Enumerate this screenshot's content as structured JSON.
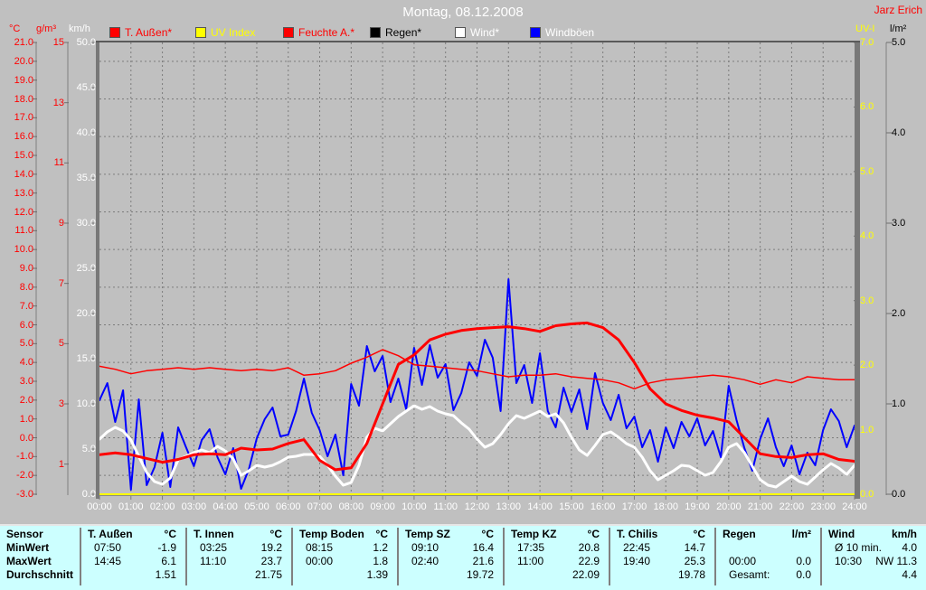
{
  "header": {
    "title": "Montag, 08.12.2008",
    "watermark": "Jarz Erich"
  },
  "legend": [
    {
      "label": "T. Außen*",
      "swatch": "#ff0000",
      "label_color": "#ff0000"
    },
    {
      "label": "UV Index",
      "swatch": "#ffff00",
      "label_color": "#ffff00"
    },
    {
      "label": "Feuchte A.*",
      "swatch": "#ff0000",
      "label_color": "#ff0000"
    },
    {
      "label": "Regen*",
      "swatch": "#000000",
      "label_color": "#000000"
    },
    {
      "label": "Wind*",
      "swatch": "#ffffff",
      "label_color": "#ffffff"
    },
    {
      "label": "Windböen",
      "swatch": "#0000ff",
      "label_color": "#ffffff"
    }
  ],
  "chart_data": {
    "type": "line",
    "title": "Montag, 08.12.2008",
    "x_axis": {
      "unit": "time",
      "range_hours": [
        0,
        24
      ],
      "tick_labels": [
        "00:00",
        "01:00",
        "02:00",
        "03:00",
        "04:00",
        "05:00",
        "06:00",
        "07:00",
        "08:00",
        "09:00",
        "10:00",
        "11:00",
        "12:00",
        "13:00",
        "14:00",
        "15:00",
        "16:00",
        "17:00",
        "18:00",
        "19:00",
        "20:00",
        "21:00",
        "22:00",
        "23:00",
        "24:00"
      ]
    },
    "grid": {
      "vertical": "every hour",
      "horizontal": "every 2 °C"
    },
    "legend_position": "top",
    "axes": [
      {
        "id": "temp_c",
        "label": "°C",
        "side": "left",
        "color": "#ff0000",
        "min": -3,
        "max": 21,
        "tick_step": 1,
        "decimals": 1
      },
      {
        "id": "humidity",
        "label": "g/m³",
        "side": "left",
        "color": "#ff0000",
        "min": 0,
        "max": 15,
        "tick_step": 2,
        "decimals": 0
      },
      {
        "id": "wind",
        "label": "km/h",
        "side": "left",
        "color": "#ffffff",
        "min": 0,
        "max": 50,
        "tick_step": 5,
        "decimals": 1
      },
      {
        "id": "uv",
        "label": "UV-I",
        "side": "right",
        "color": "#ffff00",
        "min": 0,
        "max": 7,
        "tick_step": 1,
        "decimals": 1
      },
      {
        "id": "rain",
        "label": "l/m²",
        "side": "right",
        "color": "#000000",
        "min": 0,
        "max": 5,
        "tick_step": 1,
        "decimals": 1
      }
    ],
    "series": [
      {
        "name": "T. Außen*",
        "axis": "temp_c",
        "color": "#ff0000",
        "width": 3,
        "step_h": 0.5,
        "values": [
          -0.9,
          -0.8,
          -0.9,
          -1.1,
          -1.3,
          -1.15,
          -0.9,
          -0.85,
          -0.9,
          -0.55,
          -0.65,
          -0.6,
          -0.3,
          -0.1,
          -1.2,
          -1.7,
          -1.6,
          -0.3,
          1.8,
          3.9,
          4.4,
          5.2,
          5.5,
          5.7,
          5.8,
          5.85,
          5.9,
          5.8,
          5.65,
          5.95,
          6.05,
          6.1,
          5.85,
          5.2,
          4.0,
          2.6,
          1.8,
          1.45,
          1.2,
          1.05,
          0.85,
          0.0,
          -0.85,
          -1.0,
          -1.05,
          -0.9,
          -0.85,
          -1.15,
          -1.25
        ]
      },
      {
        "name": "UV Index",
        "axis": "uv",
        "color": "#ffff00",
        "width": 2,
        "step_h": 24,
        "values": [
          0,
          0
        ]
      },
      {
        "name": "Feuchte A.*",
        "axis": "humidity",
        "color": "#ff0000",
        "width": 1.5,
        "step_h": 0.5,
        "values": [
          4.25,
          4.15,
          4.0,
          4.1,
          4.15,
          4.2,
          4.15,
          4.2,
          4.15,
          4.1,
          4.15,
          4.1,
          4.2,
          3.95,
          4.0,
          4.1,
          4.35,
          4.55,
          4.8,
          4.6,
          4.3,
          4.25,
          4.2,
          4.15,
          4.1,
          4.0,
          3.9,
          3.95,
          3.95,
          4.0,
          3.9,
          3.85,
          3.8,
          3.7,
          3.5,
          3.7,
          3.8,
          3.85,
          3.9,
          3.95,
          3.9,
          3.8,
          3.65,
          3.8,
          3.7,
          3.9,
          3.85,
          3.8,
          3.8
        ]
      },
      {
        "name": "Regen*",
        "axis": "rain",
        "color": "#000000",
        "width": 1.5,
        "step_h": 24,
        "values": [
          0,
          0
        ]
      },
      {
        "name": "Wind*",
        "axis": "wind",
        "color": "#ffffff",
        "width": 3,
        "step_h": 0.25,
        "values": [
          6.1,
          6.9,
          7.4,
          7.0,
          6.0,
          4.2,
          2.4,
          1.4,
          1.1,
          1.8,
          3.8,
          4.2,
          4.6,
          4.9,
          4.6,
          5.3,
          4.8,
          3.9,
          2.1,
          2.6,
          3.2,
          3.0,
          3.2,
          3.6,
          4.1,
          4.2,
          4.4,
          4.4,
          4.2,
          3.2,
          2.0,
          1.0,
          1.3,
          3.2,
          6.3,
          7.3,
          7.0,
          7.8,
          8.6,
          9.2,
          9.8,
          9.4,
          9.7,
          9.2,
          8.9,
          8.7,
          7.9,
          7.2,
          6.1,
          5.2,
          5.6,
          6.6,
          7.8,
          8.7,
          8.4,
          8.8,
          9.2,
          8.6,
          8.9,
          7.9,
          6.3,
          4.9,
          4.3,
          5.4,
          6.6,
          6.9,
          6.3,
          5.6,
          5.2,
          4.1,
          2.6,
          1.6,
          2.1,
          2.6,
          3.2,
          3.1,
          2.6,
          2.1,
          2.4,
          3.6,
          5.2,
          5.6,
          4.6,
          3.1,
          1.6,
          1.0,
          0.8,
          1.4,
          2.0,
          1.4,
          1.1,
          1.9,
          2.7,
          3.4,
          2.9,
          2.2,
          3.2
        ]
      },
      {
        "name": "Windböen",
        "axis": "wind",
        "color": "#0000ff",
        "width": 2,
        "step_h": 0.25,
        "values": [
          10.4,
          12.3,
          8.0,
          11.5,
          0.5,
          10.5,
          1.0,
          3.0,
          6.8,
          0.8,
          7.4,
          5.2,
          3.1,
          6.0,
          7.2,
          4.1,
          2.2,
          5.1,
          0.6,
          2.8,
          6.2,
          8.3,
          9.6,
          6.4,
          6.6,
          9.2,
          12.8,
          9.0,
          7.1,
          4.2,
          6.6,
          2.1,
          12.2,
          9.8,
          16.4,
          13.6,
          15.3,
          10.2,
          12.8,
          9.4,
          16.2,
          12.1,
          16.5,
          12.9,
          14.4,
          9.3,
          11.2,
          14.6,
          13.1,
          17.1,
          15.1,
          9.2,
          23.8,
          12.3,
          14.3,
          10.1,
          15.6,
          9.2,
          7.4,
          11.8,
          9.1,
          11.6,
          7.2,
          13.4,
          10.1,
          8.2,
          11.0,
          7.3,
          8.6,
          5.2,
          7.1,
          3.6,
          7.4,
          5.1,
          8.0,
          6.4,
          8.4,
          5.4,
          7.0,
          4.1,
          12.0,
          8.2,
          5.1,
          2.6,
          6.1,
          8.4,
          5.2,
          3.1,
          5.4,
          2.2,
          4.6,
          3.2,
          7.1,
          9.4,
          8.1,
          5.2,
          7.6
        ]
      }
    ]
  },
  "summary_table": {
    "row_labels": [
      "Sensor",
      "MinWert",
      "MaxWert",
      "Durchschnitt"
    ],
    "groups": [
      {
        "name": "T. Außen",
        "unit": "°C",
        "min_time": "07:50",
        "min_val": "-1.9",
        "max_time": "14:45",
        "max_val": "6.1",
        "avg_label": "",
        "avg_val": "1.51"
      },
      {
        "name": "T. Innen",
        "unit": "°C",
        "min_time": "03:25",
        "min_val": "19.2",
        "max_time": "11:10",
        "max_val": "23.7",
        "avg_label": "",
        "avg_val": "21.75"
      },
      {
        "name": "Temp Boden",
        "unit": "°C",
        "min_time": "08:15",
        "min_val": "1.2",
        "max_time": "00:00",
        "max_val": "1.8",
        "avg_label": "",
        "avg_val": "1.39"
      },
      {
        "name": "Temp SZ",
        "unit": "°C",
        "min_time": "09:10",
        "min_val": "16.4",
        "max_time": "02:40",
        "max_val": "21.6",
        "avg_label": "",
        "avg_val": "19.72"
      },
      {
        "name": "Temp KZ",
        "unit": "°C",
        "min_time": "17:35",
        "min_val": "20.8",
        "max_time": "11:00",
        "max_val": "22.9",
        "avg_label": "",
        "avg_val": "22.09"
      },
      {
        "name": "T. Chilis",
        "unit": "°C",
        "min_time": "22:45",
        "min_val": "14.7",
        "max_time": "19:40",
        "max_val": "25.3",
        "avg_label": "",
        "avg_val": "19.78"
      },
      {
        "name": "Regen",
        "unit": "l/m²",
        "min_time": "",
        "min_val": "",
        "max_time": "00:00",
        "max_val": "0.0",
        "avg_label": "Gesamt:",
        "avg_val": "0.0"
      },
      {
        "name": "Wind",
        "unit": "km/h",
        "min_time": "Ø 10 min.",
        "min_val": "4.0",
        "max_time": "10:30",
        "max_val": "NW 11.3",
        "avg_label": "",
        "avg_val": "4.4"
      }
    ]
  }
}
